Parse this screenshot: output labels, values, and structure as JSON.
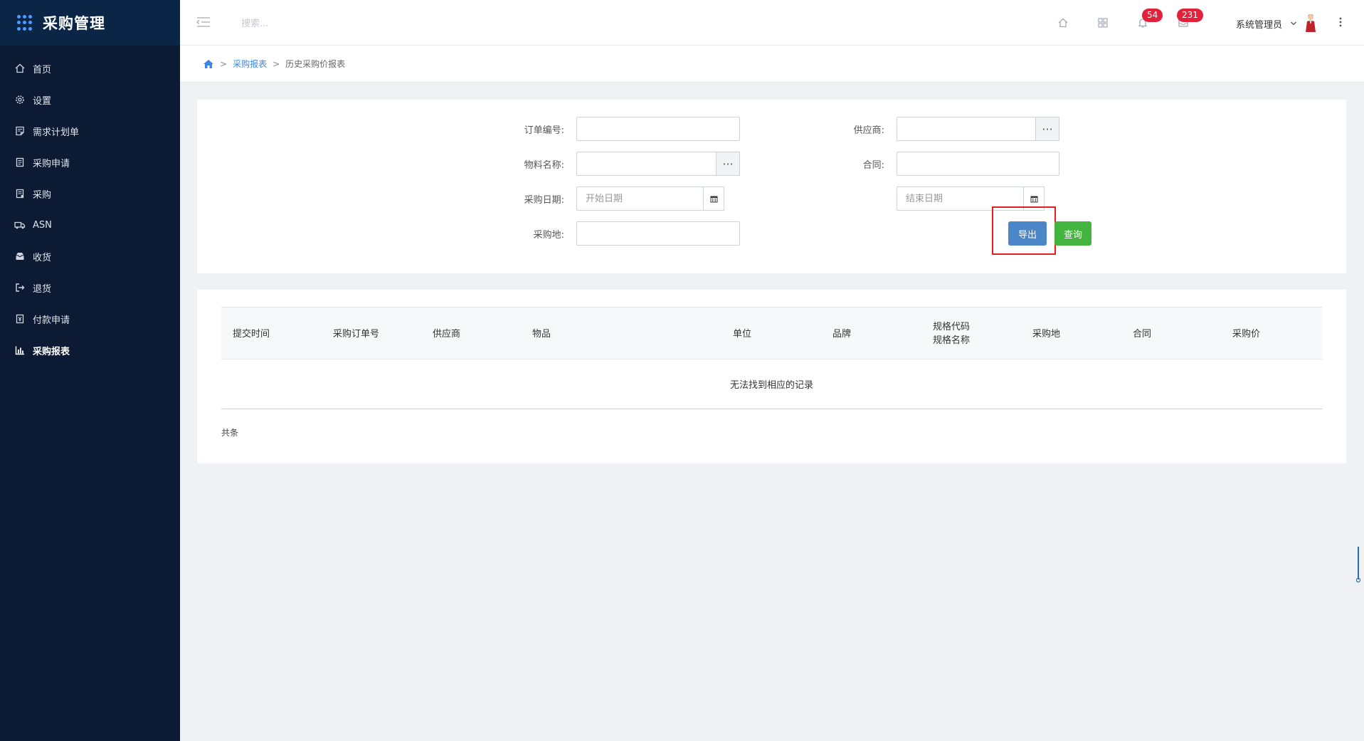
{
  "app": {
    "title": "采购管理"
  },
  "sidebar": {
    "items": [
      {
        "label": "首页",
        "icon": "home-icon"
      },
      {
        "label": "设置",
        "icon": "gear-icon"
      },
      {
        "label": "需求计划单",
        "icon": "plan-icon"
      },
      {
        "label": "采购申请",
        "icon": "document-icon"
      },
      {
        "label": "采购",
        "icon": "purchase-icon"
      },
      {
        "label": "ASN",
        "icon": "truck-icon"
      },
      {
        "label": "收货",
        "icon": "inbox-icon"
      },
      {
        "label": "退货",
        "icon": "return-icon"
      },
      {
        "label": "付款申请",
        "icon": "payment-icon"
      },
      {
        "label": "采购报表",
        "icon": "bar-chart-icon",
        "active": true
      }
    ]
  },
  "header": {
    "search_placeholder": "搜索...",
    "notifications_count": "54",
    "messages_count": "231",
    "user_name": "系统管理员"
  },
  "breadcrumb": {
    "level1": "采购报表",
    "level2": "历史采购价报表",
    "separator": ">"
  },
  "filters": {
    "order_no_label": "订单编号:",
    "supplier_label": "供应商:",
    "material_label": "物料名称:",
    "contract_label": "合同:",
    "purchase_date_label": "采购日期:",
    "start_date_placeholder": "开始日期",
    "end_date_placeholder": "结束日期",
    "location_label": "采购地:",
    "ellipsis": "···",
    "export_label": "导出",
    "query_label": "查询"
  },
  "table": {
    "columns": [
      "提交时间",
      "采购订单号",
      "供应商",
      "物品",
      "单位",
      "品牌",
      "规格代码",
      "规格名称",
      "采购地",
      "合同",
      "采购价"
    ],
    "empty_text": "无法找到相应的记录",
    "total_text": "共条"
  },
  "colors": {
    "sidebar_bg": "#0c1a33",
    "accent": "#3b86e0",
    "export_btn": "#4a86c8",
    "query_btn": "#43b53e",
    "badge": "#e3213a",
    "highlight": "#e02020"
  }
}
